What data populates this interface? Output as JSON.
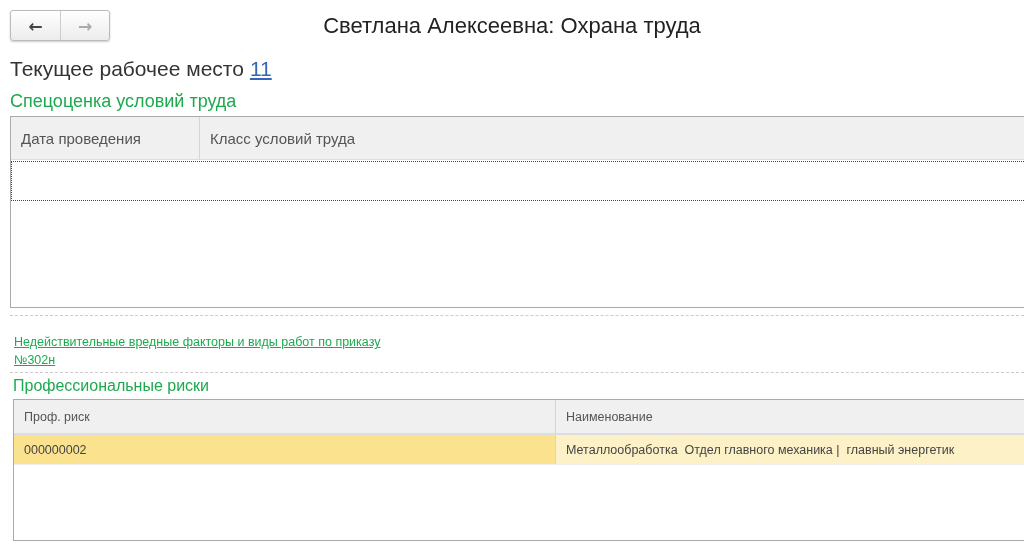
{
  "nav": [
    {
      "glyph": "←",
      "disabled": false
    },
    {
      "glyph": "→",
      "disabled": true
    }
  ],
  "window": {
    "title": "Светлана Алексеевна: Охрана труда"
  },
  "workplace": {
    "label": "Текущее рабочее место",
    "link": "11"
  },
  "assessment": {
    "heading": "Спецоценка условий труда",
    "columns": [
      "Дата проведения",
      "Класс условий труда"
    ]
  },
  "factors_link": "Недействительные вредные факторы и виды работ по приказу №302н",
  "risks": {
    "heading": "Профессиональные риски",
    "columns": [
      "Проф. риск",
      "Наименование"
    ],
    "rows": [
      {
        "cells": [
          "000000002",
          "Металлообработка  Отдел главного механика |  главный энергетик"
        ],
        "selected": true
      }
    ]
  }
}
